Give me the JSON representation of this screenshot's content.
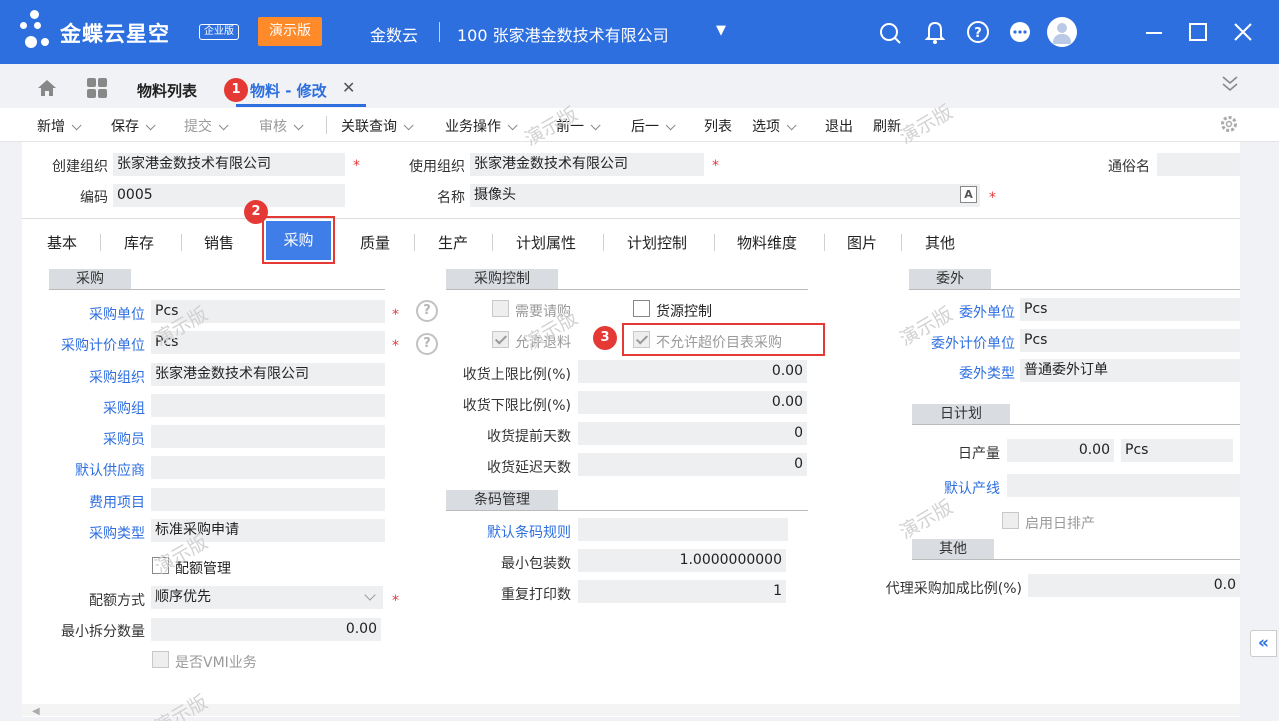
{
  "header": {
    "brand": "金蝶云星空",
    "edition": "企业版",
    "demo_badge": "演示版",
    "app": "金数云",
    "org": "100  张家港金数技术有限公司"
  },
  "tabs": {
    "list": "物料列表",
    "edit": "物料 - 修改"
  },
  "toolbar": {
    "new": "新增",
    "save": "保存",
    "submit": "提交",
    "audit": "审核",
    "related": "关联查询",
    "business": "业务操作",
    "prev": "前一",
    "next": "后一",
    "list": "列表",
    "options": "选项",
    "exit": "退出",
    "refresh": "刷新"
  },
  "header_form": {
    "create_org_label": "创建组织",
    "create_org": "张家港金数技术有限公司",
    "use_org_label": "使用组织",
    "use_org": "张家港金数技术有限公司",
    "common_name_label": "通俗名",
    "common_name": "",
    "code_label": "编码",
    "code": "0005",
    "name_label": "名称",
    "name": "摄像头",
    "lang_icon": "A"
  },
  "subtabs": [
    "基本",
    "库存",
    "销售",
    "采购",
    "质量",
    "生产",
    "计划属性",
    "计划控制",
    "物料维度",
    "图片",
    "其他"
  ],
  "purchase": {
    "section": "采购",
    "unit_label": "采购单位",
    "unit": "Pcs",
    "price_unit_label": "采购计价单位",
    "price_unit": "Pcs",
    "org_label": "采购组织",
    "org": "张家港金数技术有限公司",
    "group_label": "采购组",
    "group": "",
    "buyer_label": "采购员",
    "buyer": "",
    "supplier_label": "默认供应商",
    "supplier": "",
    "expense_label": "费用项目",
    "expense": "",
    "type_label": "采购类型",
    "type": "标准采购申请",
    "quota_label": "配额管理",
    "quota_method_label": "配额方式",
    "quota_method": "顺序优先",
    "min_split_label": "最小拆分数量",
    "min_split": "0.00",
    "vmi_label": "是否VMI业务"
  },
  "purchase_control": {
    "section": "采购控制",
    "need_request": "需要请购",
    "source_control": "货源控制",
    "allow_return": "允许退料",
    "no_over_price": "不允许超价目表采购",
    "recv_upper_label": "收货上限比例(%)",
    "recv_upper": "0.00",
    "recv_lower_label": "收货下限比例(%)",
    "recv_lower": "0.00",
    "recv_ahead_label": "收货提前天数",
    "recv_ahead": "0",
    "recv_delay_label": "收货延迟天数",
    "recv_delay": "0"
  },
  "barcode": {
    "section": "条码管理",
    "rule_label": "默认条码规则",
    "rule": "",
    "min_pack_label": "最小包装数",
    "min_pack": "1.0000000000",
    "reprint_label": "重复打印数",
    "reprint": "1"
  },
  "outsource": {
    "section": "委外",
    "unit_label": "委外单位",
    "unit": "Pcs",
    "price_unit_label": "委外计价单位",
    "price_unit": "Pcs",
    "type_label": "委外类型",
    "type": "普通委外订单"
  },
  "daily_plan": {
    "section": "日计划",
    "output_label": "日产量",
    "output": "0.00",
    "output_unit": "Pcs",
    "line_label": "默认产线",
    "line": "",
    "enable_label": "启用日排产"
  },
  "other": {
    "section": "其他",
    "agent_label": "代理采购加成比例(%)",
    "agent": "0.0"
  },
  "annotations": {
    "b1": "1",
    "b2": "2",
    "b3": "3"
  },
  "watermark": "演示版",
  "colors": {
    "brand": "#2e6fe0",
    "demo": "#ff8a2a",
    "highlight": "#e53935"
  }
}
